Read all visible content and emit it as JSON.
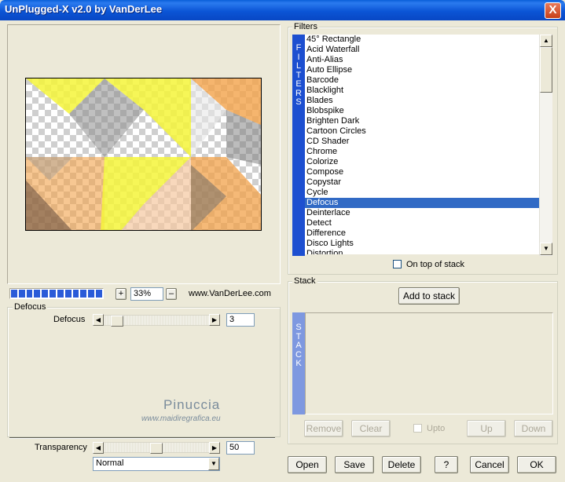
{
  "window": {
    "title": "UnPlugged-X v2.0 by VanDerLee",
    "close_label": "X"
  },
  "preview": {
    "zoom_value": "33%",
    "zoom_in_label": "+",
    "zoom_out_label": "–",
    "website": "www.VanDerLee.com",
    "progress_segments": 12
  },
  "defocus_group": {
    "title": "Defocus",
    "param_label": "Defocus",
    "param_value": "3",
    "param_fraction": 0.08
  },
  "transparency": {
    "label": "Transparency",
    "value": "50",
    "fraction": 0.5,
    "blend_mode": "Normal"
  },
  "watermark": {
    "line1": "Pinuccia",
    "line2": "www.maidiregrafica.eu"
  },
  "filters": {
    "title": "Filters",
    "side_label": [
      "F",
      "I",
      "L",
      "T",
      "E",
      "R",
      "S"
    ],
    "items": [
      "45° Rectangle",
      "Acid Waterfall",
      "Anti-Alias",
      "Auto Ellipse",
      "Barcode",
      "Blacklight",
      "Blades",
      "Blobspike",
      "Brighten Dark",
      "Cartoon Circles",
      "CD Shader",
      "Chrome",
      "Colorize",
      "Compose",
      "Copystar",
      "Cycle",
      "Defocus",
      "Deinterlace",
      "Detect",
      "Difference",
      "Disco Lights",
      "Distortion"
    ],
    "selected": "Defocus",
    "on_top_label": "On top of stack"
  },
  "stack": {
    "title": "Stack",
    "add_label": "Add to stack",
    "side_label": [
      "S",
      "T",
      "A",
      "C",
      "K"
    ],
    "remove_label": "Remove",
    "clear_label": "Clear",
    "upto_label": "Upto",
    "up_label": "Up",
    "down_label": "Down"
  },
  "footer": {
    "open_label": "Open",
    "save_label": "Save",
    "delete_label": "Delete",
    "help_label": "?",
    "cancel_label": "Cancel",
    "ok_label": "OK"
  },
  "colors": {
    "selection": "#316ac5",
    "filters_side": "#1d4fd0",
    "stack_side": "#7e98e0",
    "progress": "#2a5bd8"
  }
}
